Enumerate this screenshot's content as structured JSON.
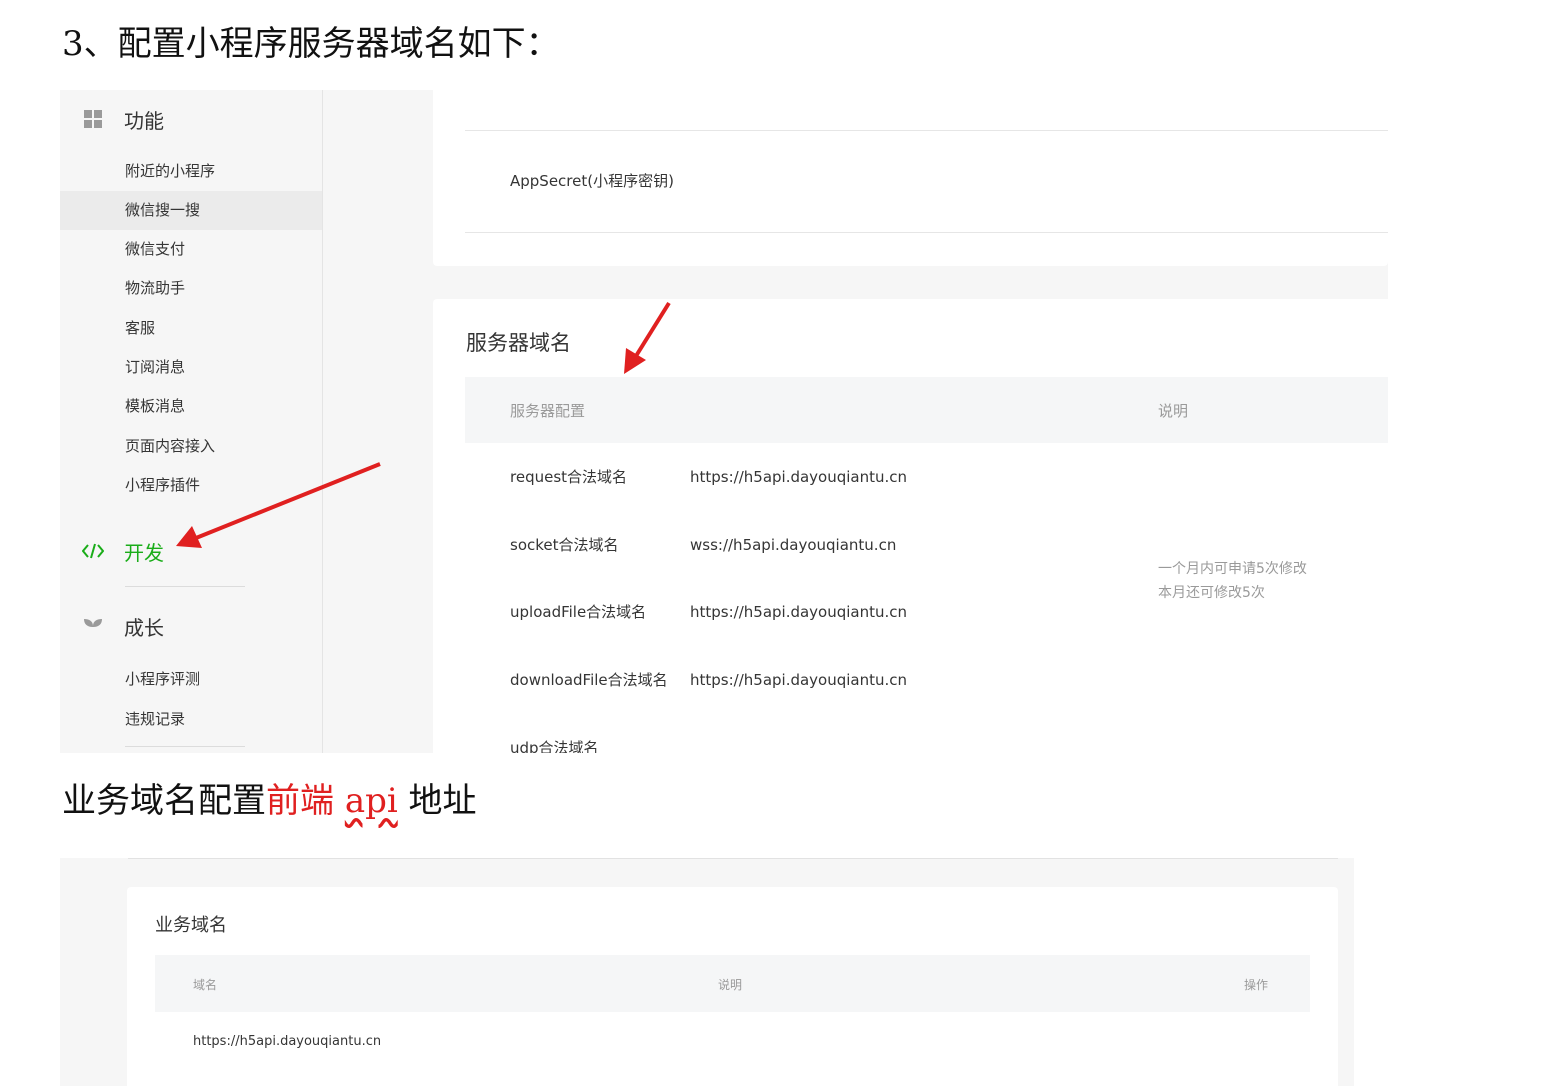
{
  "heading1": "3、配置小程序服务器域名如下：",
  "heading2": {
    "part1": "业务域名配置",
    "part2": "前端 ",
    "part3": "api",
    "part4": " 地址"
  },
  "sidebar": {
    "group_function": "功能",
    "function_items": [
      "附近的小程序",
      "微信搜一搜",
      "微信支付",
      "物流助手",
      "客服",
      "订阅消息",
      "模板消息",
      "页面内容接入",
      "小程序插件"
    ],
    "group_dev": "开发",
    "group_growth": "成长",
    "growth_items": [
      "小程序评测",
      "违规记录"
    ]
  },
  "top_card": {
    "appsecret_label": "AppSecret(小程序密钥)"
  },
  "server_domain": {
    "title": "服务器域名",
    "col_config": "服务器配置",
    "col_desc": "说明",
    "rows": [
      {
        "key": "request合法域名",
        "value": "https://h5api.dayouqiantu.cn"
      },
      {
        "key": "socket合法域名",
        "value": "wss://h5api.dayouqiantu.cn"
      },
      {
        "key": "uploadFile合法域名",
        "value": "https://h5api.dayouqiantu.cn"
      },
      {
        "key": "downloadFile合法域名",
        "value": "https://h5api.dayouqiantu.cn"
      },
      {
        "key": "udp合法域名",
        "value": ""
      }
    ],
    "note_line1": "一个月内可申请5次修改",
    "note_line2": "本月还可修改5次"
  },
  "business_domain": {
    "title": "业务域名",
    "col_domain": "域名",
    "col_desc": "说明",
    "col_action": "操作",
    "domain": "https://h5api.dayouqiantu.cn"
  },
  "colors": {
    "active_green": "#1aad19",
    "arrow_red": "#e02020"
  }
}
